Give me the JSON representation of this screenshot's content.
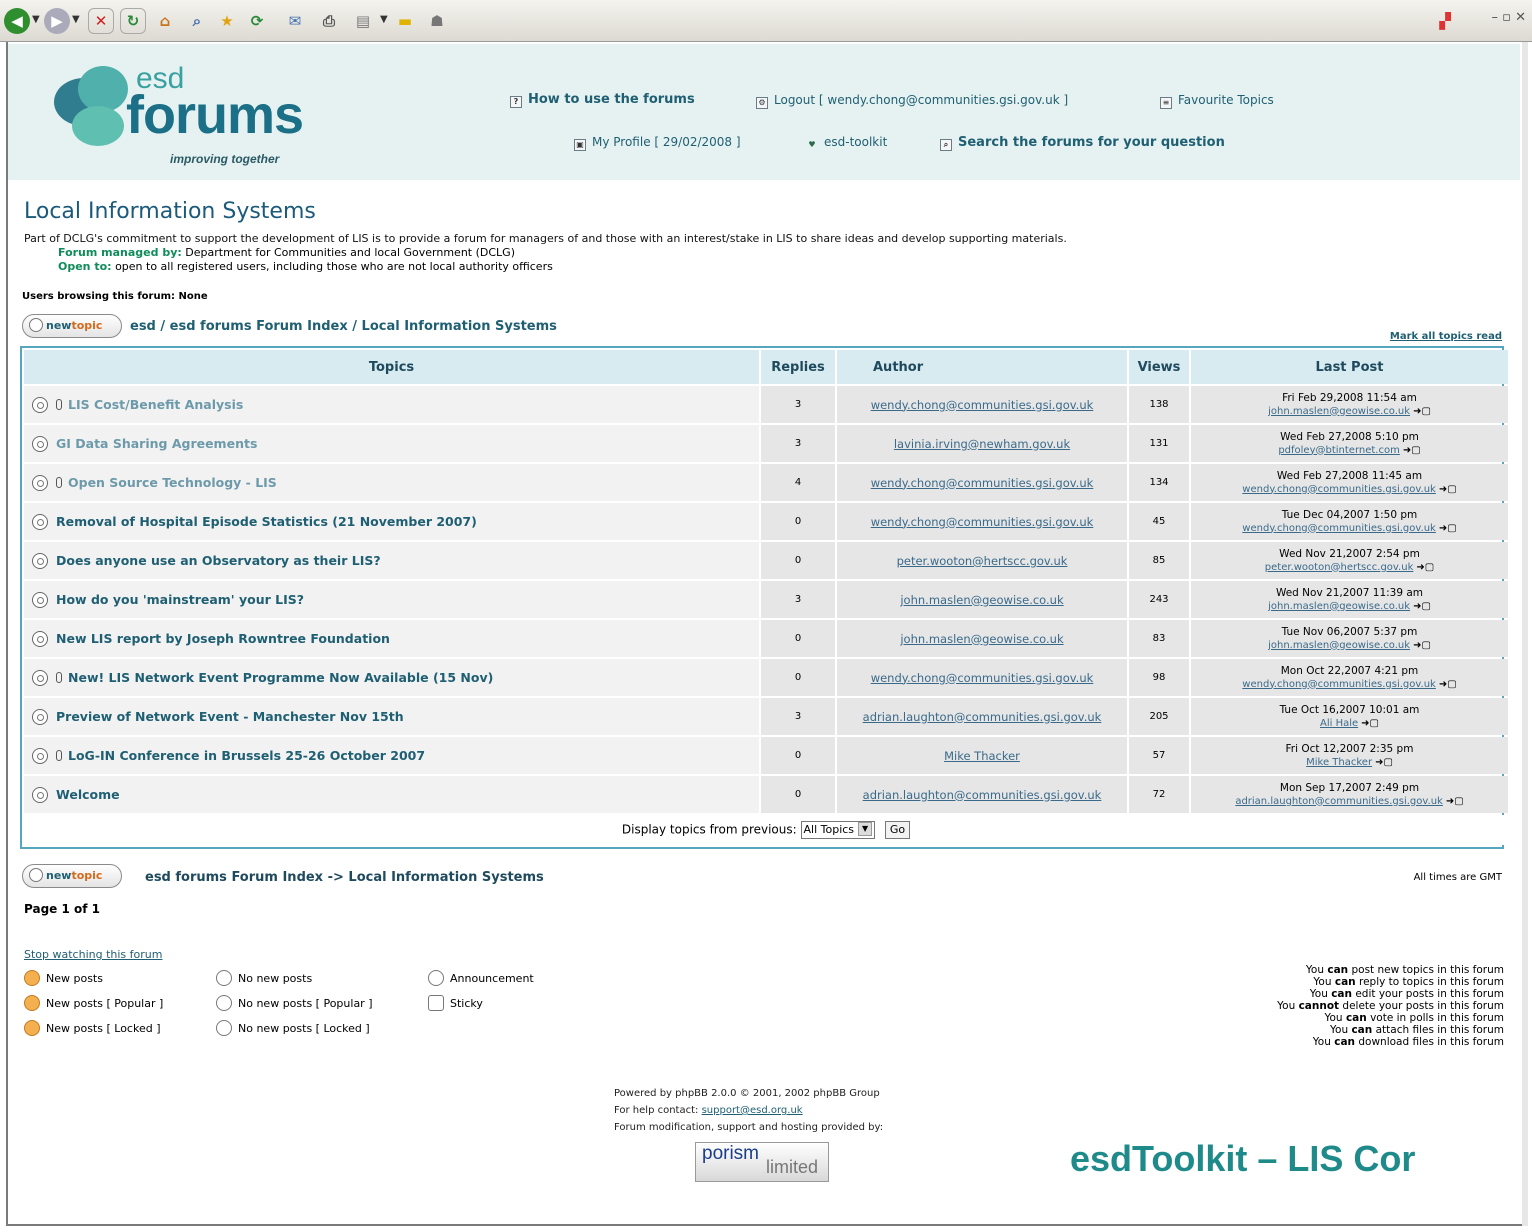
{
  "header": {
    "logo_esd": "esd",
    "logo_forums": "forums",
    "logo_tagline": "improving together",
    "nav": {
      "how_to_use": "How to use the forums",
      "logout": "Logout [ wendy.chong@communities.gsi.gov.uk ]",
      "favourite_topics": "Favourite Topics",
      "my_profile": "My Profile [ 29/02/2008 ]",
      "esd_toolkit": "esd-toolkit",
      "search": "Search the forums for your question"
    }
  },
  "forum": {
    "title": "Local Information Systems",
    "description": "Part of DCLG's commitment to support the development of LIS is to provide a forum for managers of and those with an interest/stake in LIS to share ideas and develop supporting materials.",
    "managed_label": "Forum managed by:",
    "managed_value": "Department for Communities and local Government (DCLG)",
    "open_label": "Open to:",
    "open_value": "open to all registered users, including those who are not local authority officers",
    "users_browsing": "Users browsing this forum: None"
  },
  "actions": {
    "new_label": "new",
    "topic_label": "topic",
    "breadcrumb": "esd / esd forums Forum Index / Local Information Systems",
    "mark_all_read": "Mark all topics read"
  },
  "table": {
    "headers": {
      "topics": "Topics",
      "replies": "Replies",
      "author": "Author",
      "views": "Views",
      "last_post": "Last Post"
    },
    "rows": [
      {
        "title": "LIS Cost/Benefit Analysis",
        "replies": "3",
        "author": "wendy.chong@communities.gsi.gov.uk",
        "views": "138",
        "last_date": "Fri Feb 29,2008 11:54 am",
        "last_user": "john.maslen@geowise.co.uk"
      },
      {
        "title": "GI Data Sharing Agreements",
        "replies": "3",
        "author": "lavinia.irving@newham.gov.uk",
        "views": "131",
        "last_date": "Wed Feb 27,2008 5:10 pm",
        "last_user": "pdfoley@btinternet.com"
      },
      {
        "title": "Open Source Technology - LIS",
        "replies": "4",
        "author": "wendy.chong@communities.gsi.gov.uk",
        "views": "134",
        "last_date": "Wed Feb 27,2008 11:45 am",
        "last_user": "wendy.chong@communities.gsi.gov.uk"
      },
      {
        "title": "Removal of Hospital Episode Statistics (21 November 2007)",
        "replies": "0",
        "author": "wendy.chong@communities.gsi.gov.uk",
        "views": "45",
        "last_date": "Tue Dec 04,2007 1:50 pm",
        "last_user": "wendy.chong@communities.gsi.gov.uk"
      },
      {
        "title": "Does anyone use an Observatory as their LIS?",
        "replies": "0",
        "author": "peter.wooton@hertscc.gov.uk",
        "views": "85",
        "last_date": "Wed Nov 21,2007 2:54 pm",
        "last_user": "peter.wooton@hertscc.gov.uk"
      },
      {
        "title": "How do you 'mainstream' your LIS?",
        "replies": "3",
        "author": "john.maslen@geowise.co.uk",
        "views": "243",
        "last_date": "Wed Nov 21,2007 11:39 am",
        "last_user": "john.maslen@geowise.co.uk"
      },
      {
        "title": "New LIS report by Joseph Rowntree Foundation",
        "replies": "0",
        "author": "john.maslen@geowise.co.uk",
        "views": "83",
        "last_date": "Tue Nov 06,2007 5:37 pm",
        "last_user": "john.maslen@geowise.co.uk"
      },
      {
        "title": "New! LIS Network Event Programme Now Available (15 Nov)",
        "replies": "0",
        "author": "wendy.chong@communities.gsi.gov.uk",
        "views": "98",
        "last_date": "Mon Oct 22,2007 4:21 pm",
        "last_user": "wendy.chong@communities.gsi.gov.uk"
      },
      {
        "title": "Preview of Network Event - Manchester Nov 15th",
        "replies": "3",
        "author": "adrian.laughton@communities.gsi.gov.uk",
        "views": "205",
        "last_date": "Tue Oct 16,2007 10:01 am",
        "last_user": "Ali Hale"
      },
      {
        "title": "LoG-IN Conference in Brussels 25-26 October 2007",
        "replies": "0",
        "author": "Mike Thacker",
        "views": "57",
        "last_date": "Fri Oct 12,2007 2:35 pm",
        "last_user": "Mike Thacker"
      },
      {
        "title": "Welcome",
        "replies": "0",
        "author": "adrian.laughton@communities.gsi.gov.uk",
        "views": "72",
        "last_date": "Mon Sep 17,2007 2:49 pm",
        "last_user": "adrian.laughton@communities.gsi.gov.uk"
      }
    ],
    "display_label": "Display topics from previous:",
    "display_value": "All Topics",
    "go_label": "Go"
  },
  "footer": {
    "breadcrumb2": "esd forums Forum Index -> Local Information Systems",
    "all_times": "All times are GMT",
    "page_of": "Page 1 of 1",
    "stop_watching": "Stop watching this forum",
    "legend": {
      "new_posts": "New posts",
      "no_new_posts": "No new posts",
      "announcement": "Announcement",
      "new_popular": "New posts [ Popular ]",
      "no_new_popular": "No new posts [ Popular ]",
      "sticky": "Sticky",
      "new_locked": "New posts [ Locked ]",
      "no_new_locked": "No new posts [ Locked ]"
    },
    "permissions": [
      {
        "pre": "You",
        "verb": "can",
        "post": "post new topics in this forum"
      },
      {
        "pre": "You",
        "verb": "can",
        "post": "reply to topics in this forum"
      },
      {
        "pre": "You",
        "verb": "can",
        "post": "edit your posts in this forum"
      },
      {
        "pre": "You",
        "verb": "cannot",
        "post": "delete your posts in this forum"
      },
      {
        "pre": "You",
        "verb": "can",
        "post": "vote in polls in this forum"
      },
      {
        "pre": "You",
        "verb": "can",
        "post": "attach files in this forum"
      },
      {
        "pre": "You",
        "verb": "can",
        "post": "download files in this forum"
      }
    ],
    "powered_by": "Powered by phpBB 2.0.0 © 2001, 2002 phpBB Group",
    "help_label": "For help contact:",
    "help_email": "support@esd.org.uk",
    "modification": "Forum modification, support and hosting provided by:",
    "porism_1": "porism",
    "porism_2": "limited"
  },
  "slide_title": "esdToolkit – LIS Cor"
}
